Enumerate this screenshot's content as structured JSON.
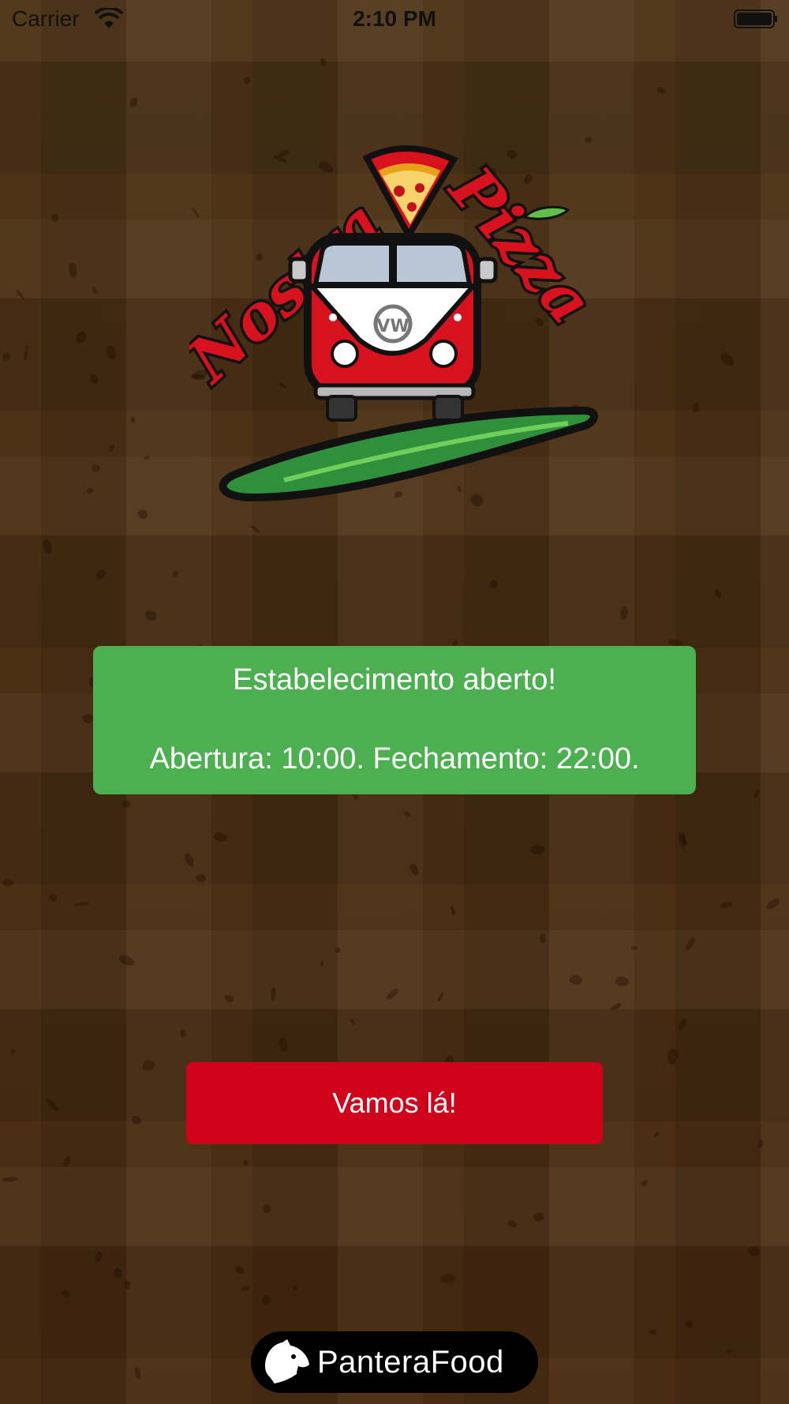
{
  "status_bar": {
    "carrier": "Carrier",
    "time": "2:10 PM"
  },
  "logo": {
    "word_left": "Nostra",
    "word_right": "Pizza",
    "badge_letters": "VW"
  },
  "status_card": {
    "headline": "Estabelecimento aberto!",
    "hours": "Abertura: 10:00. Fechamento: 22:00.",
    "color": "#4caf50"
  },
  "cta": {
    "label": "Vamos lá!",
    "color": "#d0021b"
  },
  "footer": {
    "brand_name": "PanteraFood",
    "icon": "panther-icon"
  }
}
